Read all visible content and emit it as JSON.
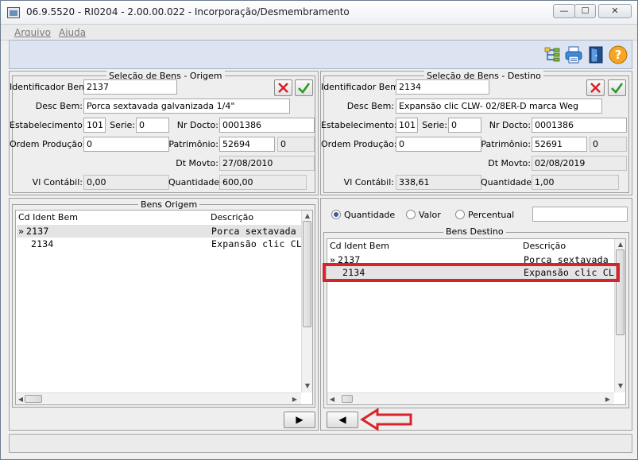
{
  "window": {
    "title": "06.9.5520 - RI0204 - 2.00.00.022 - Incorporação/Desmembramento",
    "min_glyph": "—",
    "max_glyph": "☐",
    "close_glyph": "✕"
  },
  "menu": {
    "arquivo": "Arquivo",
    "ajuda": "Ajuda"
  },
  "toolbar": {
    "icons": [
      "tree-structure-icon",
      "printer-icon",
      "exit-door-icon",
      "help-icon"
    ]
  },
  "origem": {
    "legend": "Seleção de Bens - Origem",
    "identificador_label": "Identificador Bem:",
    "identificador_value": "2137",
    "desc_label": "Desc Bem:",
    "desc_value": "Porca sextavada galvanizada 1/4\"",
    "estab_label": "Estabelecimento:",
    "estab_value": "101",
    "serie_label": "Serie:",
    "serie_value": "0",
    "nrdocto_label": "Nr Docto:",
    "nrdocto_value": "0001386",
    "ordem_label": "Ordem Produção:",
    "ordem_value": "0",
    "patrimonio_label": "Patrimônio:",
    "patrimonio_value": "52694",
    "patrimonio_seq": "0",
    "dtmovto_label": "Dt Movto:",
    "dtmovto_value": "27/08/2010",
    "vlcontabil_label": "Vl Contábil:",
    "vlcontabil_value": "0,00",
    "quantidade_label": "Quantidade:",
    "quantidade_value": "600,00"
  },
  "destino": {
    "legend": "Seleção de Bens - Destino",
    "identificador_label": "Identificador Bem:",
    "identificador_value": "2134",
    "desc_label": "Desc Bem:",
    "desc_value": "Expansão clic CLW- 02/8ER-D marca Weg",
    "estab_label": "Estabelecimento:",
    "estab_value": "101",
    "serie_label": "Serie:",
    "serie_value": "0",
    "nrdocto_label": "Nr Docto:",
    "nrdocto_value": "0001386",
    "ordem_label": "Ordem Produção:",
    "ordem_value": "0",
    "patrimonio_label": "Patrimônio:",
    "patrimonio_value": "52691",
    "patrimonio_seq": "0",
    "dtmovto_label": "Dt Movto:",
    "dtmovto_value": "02/08/2019",
    "vlcontabil_label": "Vl Contábil:",
    "vlcontabil_value": "338,61",
    "quantidade_label": "Quantidade:",
    "quantidade_value": "1,00"
  },
  "bens_origem": {
    "legend": "Bens Origem",
    "col_cd": "Cd Ident Bem",
    "col_desc": "Descrição",
    "rows": [
      {
        "marker": "»",
        "cd": "2137",
        "desc": "Porca sextavada ga"
      },
      {
        "marker": "",
        "cd": "2134",
        "desc": "Expansão clic CLW-"
      }
    ]
  },
  "rateio": {
    "quantidade": "Quantidade",
    "valor": "Valor",
    "percentual": "Percentual",
    "selected": "Quantidade"
  },
  "bens_destino": {
    "legend": "Bens Destino",
    "col_cd": "Cd Ident Bem",
    "col_desc": "Descrição",
    "rows": [
      {
        "marker": "»",
        "cd": "2137",
        "desc": "Porca sextavada ga"
      },
      {
        "marker": "",
        "cd": "2134",
        "desc": "Expansão clic CLW-"
      }
    ]
  },
  "nav": {
    "move_right": "▶",
    "move_left": "◀"
  },
  "annotation_colors": {
    "highlight": "#d9232a"
  }
}
